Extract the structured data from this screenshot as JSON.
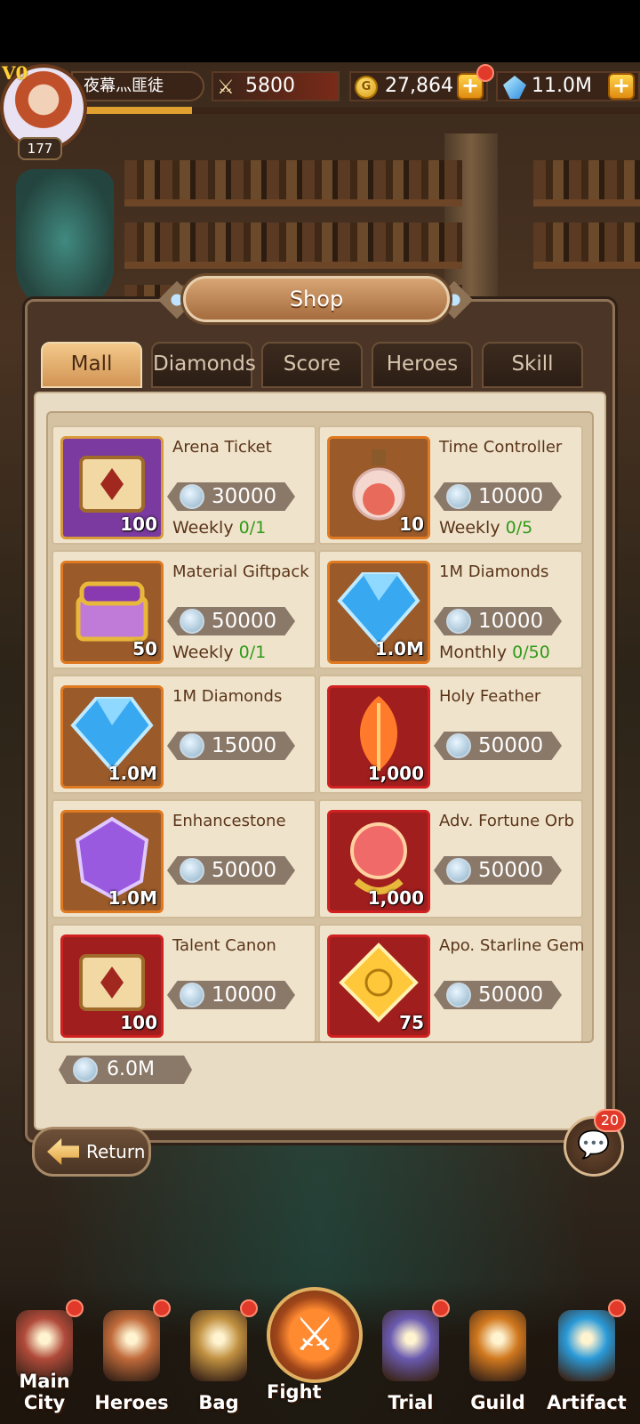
{
  "player": {
    "vip": "V0",
    "name": "夜幕灬匪徒",
    "level": "177",
    "power": "5800",
    "gold": "27,864",
    "diamonds": "11.0M",
    "exp_progress": 0.2
  },
  "shop": {
    "title": "Shop",
    "tabs": [
      {
        "label": "Mall",
        "active": true
      },
      {
        "label": "Diamonds",
        "active": false
      },
      {
        "label": "Score",
        "active": false
      },
      {
        "label": "Heroes",
        "active": false
      },
      {
        "label": "Skill",
        "active": false
      }
    ],
    "items": [
      {
        "name": "Arena Ticket",
        "price": "30000",
        "qty": "100",
        "limit_label": "Weekly",
        "limit_value": "0/1",
        "frame": "purple",
        "icon": "scroll-icon"
      },
      {
        "name": "Time Controller",
        "price": "10000",
        "qty": "10",
        "limit_label": "Weekly",
        "limit_value": "0/5",
        "frame": "brown",
        "icon": "potion-icon"
      },
      {
        "name": "Material Giftpack",
        "price": "50000",
        "qty": "50",
        "limit_label": "Weekly",
        "limit_value": "0/1",
        "frame": "brown",
        "icon": "treasure-chest-icon"
      },
      {
        "name": "1M Diamonds",
        "price": "10000",
        "qty": "1.0M",
        "limit_label": "Monthly",
        "limit_value": "0/50",
        "frame": "brown",
        "icon": "diamond-icon"
      },
      {
        "name": "1M Diamonds",
        "price": "15000",
        "qty": "1.0M",
        "limit_label": "",
        "limit_value": "",
        "frame": "brown",
        "icon": "diamond-icon"
      },
      {
        "name": "Holy Feather",
        "price": "50000",
        "qty": "1,000",
        "limit_label": "",
        "limit_value": "",
        "frame": "red",
        "icon": "feather-icon"
      },
      {
        "name": "Enhancestone",
        "price": "50000",
        "qty": "1.0M",
        "limit_label": "",
        "limit_value": "",
        "frame": "brown",
        "icon": "enhancestone-icon"
      },
      {
        "name": "Adv. Fortune Orb",
        "price": "50000",
        "qty": "1,000",
        "limit_label": "",
        "limit_value": "",
        "frame": "red",
        "icon": "orb-icon"
      },
      {
        "name": "Talent Canon",
        "price": "10000",
        "qty": "100",
        "limit_label": "",
        "limit_value": "",
        "frame": "red",
        "icon": "scroll-icon"
      },
      {
        "name": "Apo. Starline Gem",
        "price": "50000",
        "qty": "75",
        "limit_label": "",
        "limit_value": "",
        "frame": "red",
        "icon": "star-gem-icon"
      }
    ],
    "balance": "6.0M"
  },
  "buttons": {
    "return_label": "Return",
    "chat_badge": "20"
  },
  "nav": [
    {
      "label": "Main City",
      "icon": "castle-icon",
      "badge": true
    },
    {
      "label": "Heroes",
      "icon": "hero-portrait-icon",
      "badge": true
    },
    {
      "label": "Bag",
      "icon": "bag-icon",
      "badge": true
    },
    {
      "label": "Fight",
      "icon": "crossed-swords-icon",
      "badge": false
    },
    {
      "label": "Trial",
      "icon": "trial-tower-icon",
      "badge": true
    },
    {
      "label": "Guild",
      "icon": "guild-shield-icon",
      "badge": false
    },
    {
      "label": "Artifact",
      "icon": "artifact-icon",
      "badge": true
    }
  ],
  "colors": {
    "accent_gold": "#e0a030",
    "limit_green": "#2f9a18",
    "panel_brown": "#4a3526"
  }
}
